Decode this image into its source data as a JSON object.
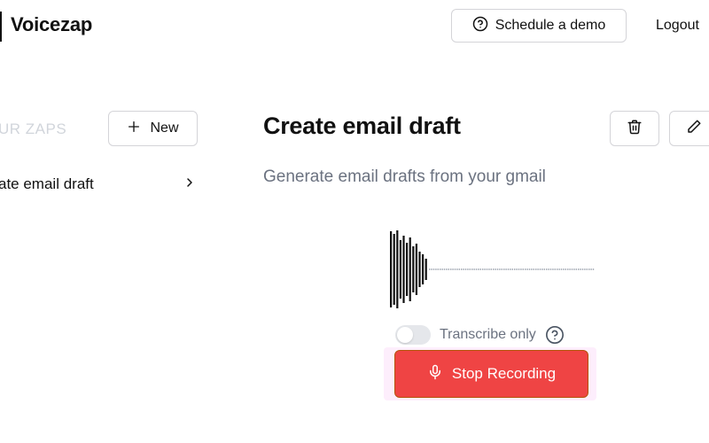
{
  "header": {
    "app_name": "Voicezap",
    "demo_label": "Schedule a demo",
    "logout_label": "Logout"
  },
  "sidebar": {
    "heading": "UR ZAPS",
    "new_label": "New",
    "items": [
      {
        "label": "ate email draft"
      }
    ]
  },
  "main": {
    "title": "Create email draft",
    "subtitle": "Generate email drafts from your gmail",
    "transcribe_label": "Transcribe only",
    "transcribe_enabled": false,
    "record_label": "Stop Recording",
    "recording": true
  },
  "icons": {
    "demo": "question-circle-icon",
    "new": "plus-icon",
    "chevron": "chevron-right-icon",
    "delete": "trash-icon",
    "edit": "pencil-icon",
    "help": "question-circle-icon",
    "record": "microphone-icon"
  },
  "colors": {
    "accent_red": "#ef4444",
    "muted_text": "#6b7280",
    "border": "#d4d4d8"
  }
}
